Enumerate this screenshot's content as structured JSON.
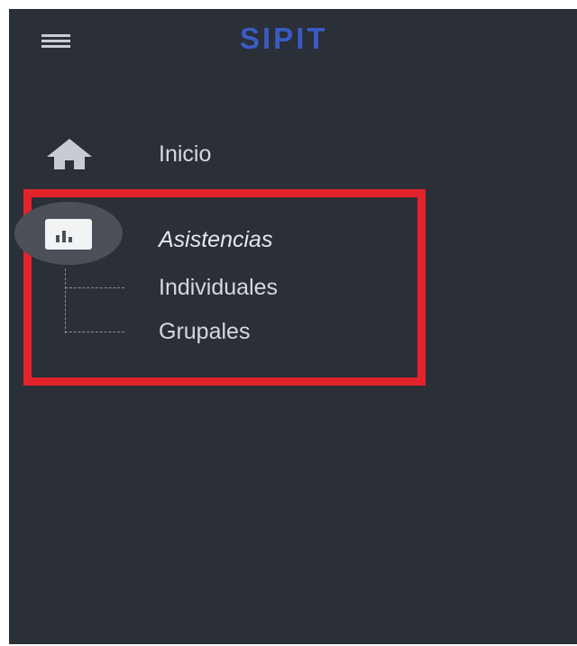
{
  "header": {
    "menu_icon": "hamburger-menu-icon",
    "title": "SIPIT",
    "title_color": "#3b5bc4"
  },
  "nav": {
    "home": {
      "label": "Inicio",
      "icon": "home-icon"
    },
    "attendance": {
      "label": "Asistencias",
      "icon": "bar-chart-icon",
      "highlighted": true,
      "highlight_color": "#e3232b",
      "children": [
        {
          "label": "Individuales"
        },
        {
          "label": "Grupales"
        }
      ]
    }
  },
  "colors": {
    "sidebar_background": "#2a2f38",
    "text": "#d6d9dd"
  }
}
